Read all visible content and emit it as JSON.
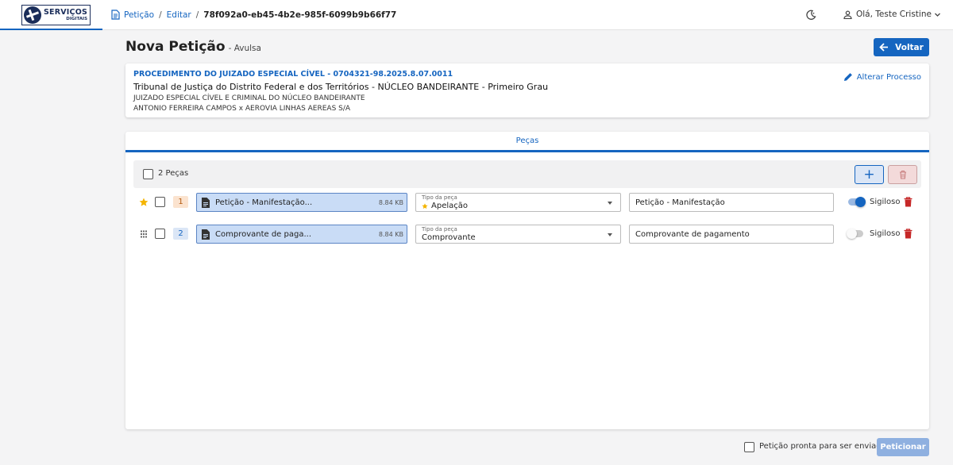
{
  "header": {
    "logo_line1": "SERVIÇOS",
    "logo_line2": "DIGITAIS",
    "breadcrumb": [
      "Petição",
      "Editar",
      "78f092a0-eb45-4b2e-985f-6099b9b66f77"
    ],
    "user_greeting": "Olá, Teste Cristine"
  },
  "page": {
    "title": "Nova Petição",
    "subtitle": "- Avulsa",
    "back_label": "Voltar"
  },
  "process": {
    "title": "PROCEDIMENTO DO JUIZADO ESPECIAL CÍVEL - 0704321-98.2025.8.07.0011",
    "court": "Tribunal de Justiça do Distrito Federal e dos Territórios - NÚCLEO BANDEIRANTE - Primeiro Grau",
    "unit": "JUIZADO ESPECIAL CÍVEL E CRIMINAL DO NÚCLEO BANDEIRANTE",
    "parties": "ANTONIO FERREIRA CAMPOS x AEROVIA LINHAS AEREAS S/A",
    "change_label": "Alterar Processo"
  },
  "pieces": {
    "tab_label": "Peças",
    "count_label": "2 Peças",
    "items": [
      {
        "number": "1",
        "file_name": "Petição - Manifestação...",
        "file_size": "8.84 KB",
        "type_label": "Tipo da peça",
        "type_value": "Apelação",
        "description": "Petição - Manifestação",
        "confidential_label": "Sigiloso",
        "confidential": true,
        "main": true
      },
      {
        "number": "2",
        "file_name": "Comprovante de paga...",
        "file_size": "8.84 KB",
        "type_label": "Tipo da peça",
        "type_value": "Comprovante",
        "description": "Comprovante de pagamento",
        "confidential_label": "Sigiloso",
        "confidential": false,
        "main": false
      }
    ]
  },
  "footer": {
    "ready_label": "Petição pronta para ser enviada",
    "submit_label": "Peticionar"
  },
  "colors": {
    "primary": "#1565c0",
    "danger": "#c62828",
    "star": "#f4b400"
  }
}
